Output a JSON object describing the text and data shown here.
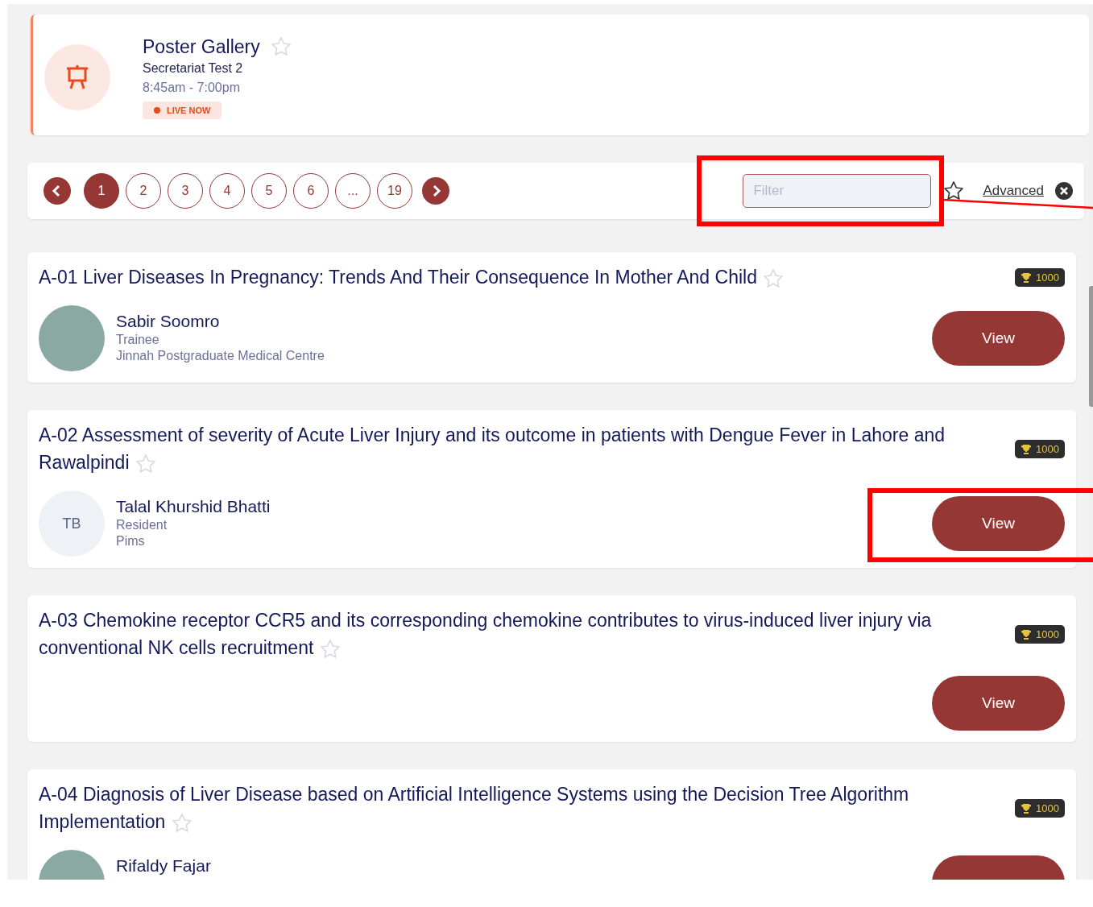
{
  "session": {
    "title": "Poster Gallery",
    "subtitle": "Secretariat Test 2",
    "time": "8:45am - 7:00pm",
    "badge": "LIVE NOW",
    "favorite": false
  },
  "pagination": {
    "pages": [
      {
        "label": "1",
        "selected": true
      },
      {
        "label": "2",
        "selected": false
      },
      {
        "label": "3",
        "selected": false
      },
      {
        "label": "4",
        "selected": false
      },
      {
        "label": "5",
        "selected": false
      },
      {
        "label": "6",
        "selected": false
      },
      {
        "label": "...",
        "selected": false
      },
      {
        "label": "19",
        "selected": false
      }
    ],
    "filter": {
      "placeholder": "Filter"
    },
    "favorites_only": false,
    "advanced": "Advanced"
  },
  "posters": [
    {
      "title": "A-01 Liver Diseases In Pregnancy: Trends And Their Consequence In Mother And Child",
      "favorite": false,
      "points": "1000",
      "author": {
        "kind": "photo",
        "name": "Sabir Soomro",
        "role": "Trainee",
        "institution": "Jinnah Postgraduate Medical Centre"
      },
      "button": "View"
    },
    {
      "title": "A-02 Assessment of severity of Acute Liver Injury and its outcome in patients with Dengue Fever in Lahore and Rawalpindi",
      "favorite": false,
      "points": "1000",
      "author": {
        "kind": "initials",
        "initials": "TB",
        "name": "Talal Khurshid Bhatti",
        "role": "Resident",
        "institution": "Pims"
      },
      "button": "View"
    },
    {
      "title": "A-03 Chemokine receptor CCR5 and its corresponding chemokine contributes to virus-induced liver injury via conventional NK cells recruitment",
      "favorite": false,
      "points": "1000",
      "button": "View"
    },
    {
      "title": "A-04 Diagnosis of Liver Disease based on Artificial Intelligence Systems using the Decision Tree Algorithm Implementation",
      "favorite": false,
      "points": "1000",
      "author": {
        "kind": "photo",
        "name": "Rifaldy Fajar"
      }
    }
  ]
}
